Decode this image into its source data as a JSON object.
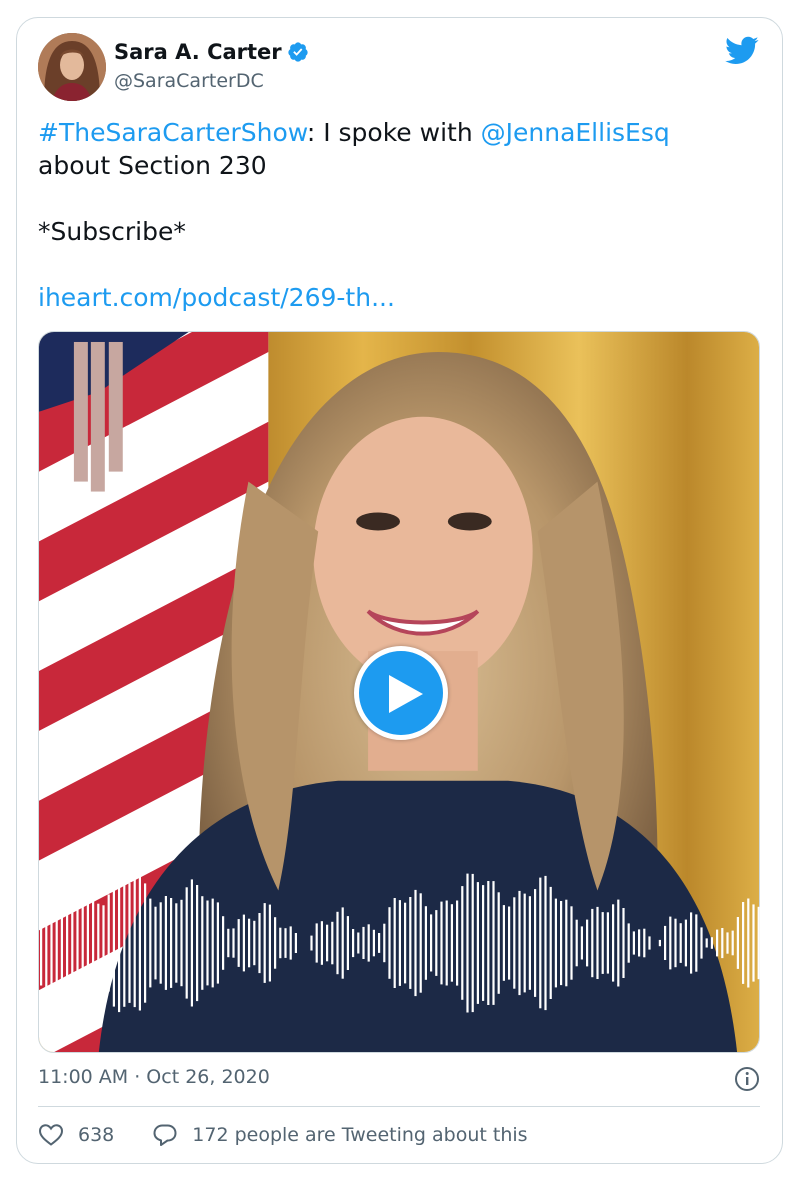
{
  "author": {
    "display_name": "Sara A. Carter",
    "handle": "@SaraCarterDC",
    "verified": true
  },
  "tweet": {
    "hashtag": "#TheSaraCarterShow",
    "text_part1": ": I spoke with ",
    "mention": "@JennaEllisEsq",
    "text_part2": "about Section 230",
    "subscribe": "*Subscribe*",
    "link": "iheart.com/podcast/269-th..."
  },
  "media": {
    "type": "audio-video",
    "play_icon": "play-icon"
  },
  "meta": {
    "timestamp": "11:00 AM · Oct 26, 2020"
  },
  "actions": {
    "like_count": "638",
    "tweeting_text": "172 people are Tweeting about this"
  },
  "colors": {
    "accent": "#1d9bf0",
    "text": "#0f1419",
    "muted": "#536471",
    "border": "#cfd9de"
  }
}
